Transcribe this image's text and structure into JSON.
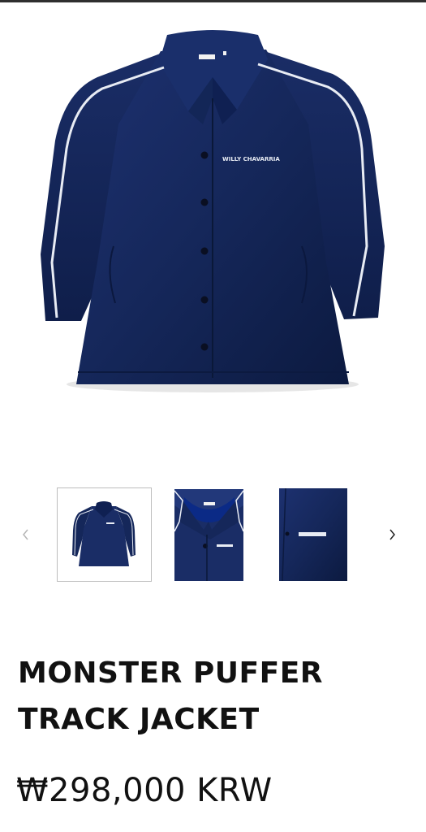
{
  "gallery": {
    "main_image_alt": "navy track jacket",
    "thumbnails": [
      {
        "label": "front view",
        "selected": true
      },
      {
        "label": "collar detail",
        "selected": false
      },
      {
        "label": "logo detail",
        "selected": false
      }
    ],
    "prev_icon": "chevron-left-icon",
    "next_icon": "chevron-right-icon"
  },
  "brand_print": "WILLY CHAVARRIA",
  "product": {
    "title_line1": "MONSTER PUFFER",
    "title_line2": "TRACK JACKET",
    "price": "₩298,000 KRW"
  },
  "colors": {
    "jacket_navy": "#15275a",
    "jacket_dark": "#0c1a40",
    "piping": "#e8ecf4",
    "text": "#111111"
  }
}
